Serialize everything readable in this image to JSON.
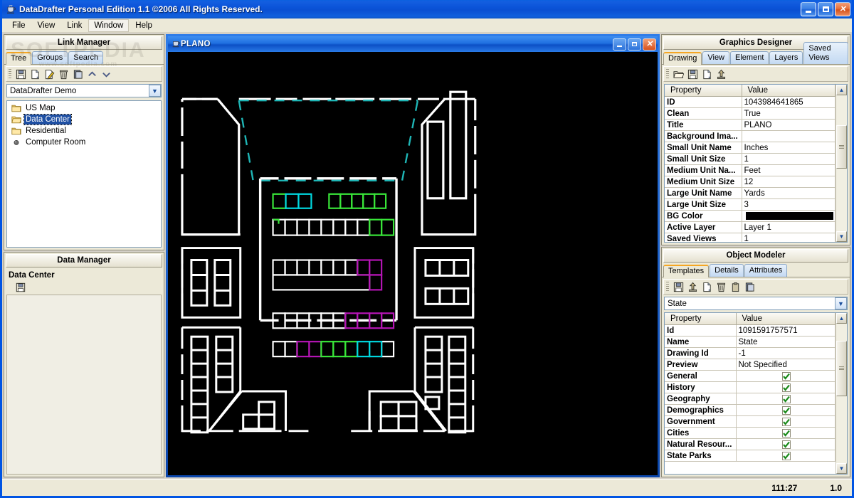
{
  "app": {
    "title": "DataDrafter Personal Edition 1.1 ©2006 All Rights Reserved.",
    "icon": "java-cup-icon",
    "watermark": "SOFTPEDIA",
    "watermark_sub": "www.softpedia.com"
  },
  "window_buttons": {
    "minimize": "minimize-button",
    "maximize": "maximize-button",
    "close": "close-button"
  },
  "menubar": {
    "items": [
      "File",
      "View",
      "Link",
      "Window",
      "Help"
    ],
    "active": "Window"
  },
  "link_manager": {
    "title": "Link Manager",
    "tabs": [
      "Tree",
      "Groups",
      "Search"
    ],
    "selected_tab": "Tree",
    "toolbar": [
      "save-icon",
      "new-document-icon",
      "edit-pencil-icon",
      "delete-trash-icon",
      "copy-icon",
      "move-up-icon",
      "move-down-icon"
    ],
    "combo_value": "DataDrafter Demo",
    "tree": [
      {
        "label": "US Map",
        "icon": "folder-icon",
        "selected": false
      },
      {
        "label": "Data Center",
        "icon": "folder-open-icon",
        "selected": true
      },
      {
        "label": "Residential",
        "icon": "folder-icon",
        "selected": false
      },
      {
        "label": "Computer Room",
        "icon": "node-dot-icon",
        "selected": false
      }
    ]
  },
  "data_manager": {
    "title": "Data Manager",
    "label": "Data Center",
    "toolbar": [
      "save-icon"
    ]
  },
  "drawing_window": {
    "title": "PLANO",
    "icon": "java-cup-icon",
    "buttons": {
      "minimize": "minimize-button",
      "maximize": "restore-button",
      "close": "close-button"
    },
    "background_color": "#000000"
  },
  "graphics_designer": {
    "title": "Graphics Designer",
    "tabs": [
      "Drawing",
      "View",
      "Element",
      "Layers",
      "Saved Views"
    ],
    "selected_tab": "Drawing",
    "toolbar": [
      "open-folder-icon",
      "save-icon",
      "new-document-icon",
      "export-up-icon"
    ],
    "columns": [
      "Property",
      "Value"
    ],
    "rows": [
      {
        "property": "ID",
        "value": "1043984641865"
      },
      {
        "property": "Clean",
        "value": "True"
      },
      {
        "property": "Title",
        "value": "PLANO"
      },
      {
        "property": "Background Ima...",
        "value": ""
      },
      {
        "property": "Small Unit Name",
        "value": "Inches"
      },
      {
        "property": "Small Unit Size",
        "value": "1"
      },
      {
        "property": "Medium Unit Na...",
        "value": "Feet"
      },
      {
        "property": "Medium Unit Size",
        "value": "12"
      },
      {
        "property": "Large Unit Name",
        "value": "Yards"
      },
      {
        "property": "Large Unit Size",
        "value": "3"
      },
      {
        "property": "BG Color",
        "value": "",
        "swatch": "#000000"
      },
      {
        "property": "Active Layer",
        "value": "Layer 1"
      },
      {
        "property": "Saved Views",
        "value": "1"
      }
    ]
  },
  "object_modeler": {
    "title": "Object Modeler",
    "tabs": [
      "Templates",
      "Details",
      "Attributes"
    ],
    "selected_tab": "Templates",
    "toolbar": [
      "save-icon",
      "export-up-icon",
      "new-document-icon",
      "delete-trash-icon",
      "paste-icon",
      "copy-icon"
    ],
    "combo_value": "State",
    "columns": [
      "Property",
      "Value"
    ],
    "rows": [
      {
        "property": "Id",
        "value": "1091591757571"
      },
      {
        "property": "Name",
        "value": "State"
      },
      {
        "property": "Drawing Id",
        "value": "-1"
      },
      {
        "property": "Preview",
        "value": "Not Specified"
      },
      {
        "property": "General",
        "checked": true
      },
      {
        "property": "History",
        "checked": true
      },
      {
        "property": "Geography",
        "checked": true
      },
      {
        "property": "Demographics",
        "checked": true
      },
      {
        "property": "Government",
        "checked": true
      },
      {
        "property": "Cities",
        "checked": true
      },
      {
        "property": "Natural Resour...",
        "checked": true
      },
      {
        "property": "State Parks",
        "checked": true
      }
    ]
  },
  "statusbar": {
    "coordinates": "111:27",
    "zoom": "1.0"
  },
  "colors": {
    "accent_orange": "#f5a623",
    "title_blue": "#0054e3",
    "panel_bg": "#ece9d8",
    "canvas_bg": "#000000",
    "wall_white": "#ffffff",
    "rack_green": "#39e639",
    "rack_cyan": "#00d8e0",
    "rack_magenta": "#b515b5",
    "guide_cyan": "#1fb6b6",
    "check_green": "#1a8a1a"
  }
}
